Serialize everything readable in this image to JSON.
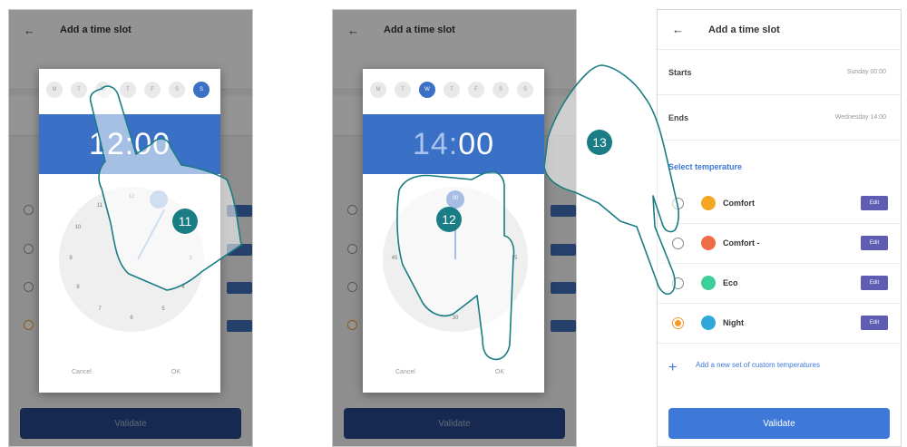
{
  "header": {
    "title": "Add a time slot",
    "back_icon": "arrow-left-icon"
  },
  "screen1": {
    "days": [
      "M",
      "T",
      "W",
      "T",
      "F",
      "S",
      "S"
    ],
    "selected_day_index": 6,
    "time": "12:00",
    "clock_numbers": [
      "12",
      "1",
      "2",
      "3",
      "4",
      "5",
      "6",
      "7",
      "8",
      "9",
      "10",
      "11"
    ],
    "cancel_label": "Cancel",
    "ok_label": "OK",
    "validate_label": "Validate",
    "step": "11"
  },
  "screen2": {
    "days": [
      "M",
      "T",
      "W",
      "T",
      "F",
      "S",
      "S"
    ],
    "selected_day_index": 2,
    "time_hours": "14:",
    "time_minutes": "00",
    "clock_numbers": [
      "00",
      "15",
      "30",
      "45"
    ],
    "cancel_label": "Cancel",
    "ok_label": "OK",
    "validate_label": "Validate",
    "step": "12"
  },
  "screen3": {
    "starts_label": "Starts",
    "starts_value": "Sunday 00:00",
    "ends_label": "Ends",
    "ends_value": "Wednesday 14:00",
    "select_label": "Select temperature",
    "temperatures": [
      {
        "name": "Comfort",
        "color": "#f5a623",
        "selected": false,
        "edit": "Edit"
      },
      {
        "name": "Comfort -",
        "color": "#ef6c44",
        "selected": false,
        "edit": "Edit"
      },
      {
        "name": "Eco",
        "color": "#3ccf9a",
        "selected": false,
        "edit": "Edit"
      },
      {
        "name": "Night",
        "color": "#2fa8d8",
        "selected": true,
        "edit": "Edit"
      }
    ],
    "add_label": "Add a new set of custom temperatures",
    "validate_label": "Validate",
    "step": "13"
  }
}
